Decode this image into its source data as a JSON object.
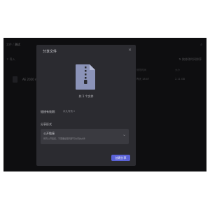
{
  "topbar": {
    "breadcrumb_root": "文件",
    "breadcrumb_sep": "/",
    "breadcrumb_current": "测试",
    "search_icon_glyph": "⌕"
  },
  "toolbar": {
    "import_label": "⇪ 导入",
    "right_label": "⇅ 按修改时间排序"
  },
  "table": {
    "headers": [
      "修改时间",
      "大小"
    ],
    "row": {
      "name": "AE 2020 n",
      "time": "昨天 18:07",
      "size": "2.11 GB"
    }
  },
  "modal": {
    "title": "分享文件",
    "close_glyph": "×",
    "file_count": "共 1 个文件",
    "validity_label": "链接有效期:",
    "validity_value": "永久有效 ▾",
    "form_label": "分享形式",
    "form_title": "公开链接",
    "form_desc": "所有公开链接、不需要提取码即可访问的文件",
    "chevron_glyph": "⌄",
    "create_label": "创建分享"
  },
  "colors": {
    "accent": "#5b63d8",
    "modal_bg": "#2b2b30",
    "app_bg": "#1b1b1e"
  }
}
